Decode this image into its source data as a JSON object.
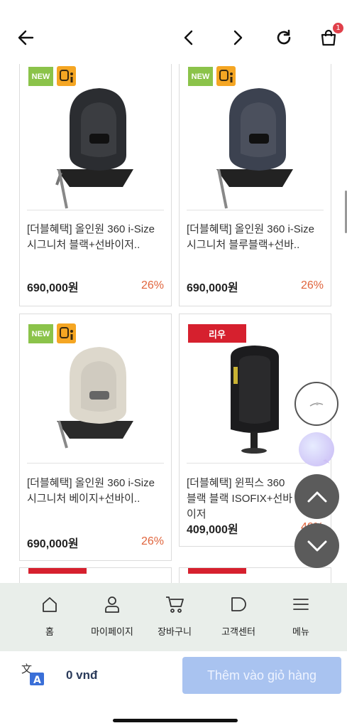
{
  "header": {
    "back_icon": "arrow-left-icon",
    "prev_icon": "chevron-left-icon",
    "next_icon": "chevron-right-icon",
    "reload_icon": "reload-icon",
    "cart_icon": "shopping-bag-icon",
    "cart_count": "1"
  },
  "products": [
    {
      "badges": [
        "NEW"
      ],
      "name": "[더블혜택] 올인원 360 i-Size 시그니처 블랙+선바이저..",
      "price": "690,000원",
      "discount": "26%",
      "seat_color": "#2b2d31"
    },
    {
      "badges": [
        "NEW"
      ],
      "name": "[더블혜택] 올인원 360 i-Size 시그니처 블루블랙+선바..",
      "price": "690,000원",
      "discount": "26%",
      "seat_color": "#3c4250"
    },
    {
      "badges": [
        "NEW"
      ],
      "name": "[더블혜택] 올인원 360 i-Size 시그니처 베이지+선바이..",
      "price": "690,000원",
      "discount": "26%",
      "seat_color": "#ddd8cc"
    },
    {
      "badges": [
        "리우"
      ],
      "name": "[더블혜택] 윈픽스 360 블랙 블랙 ISOFIX+선바이저",
      "price": "409,000원",
      "discount": "40%",
      "seat_color": "#1c1c1e"
    }
  ],
  "bottom_nav": [
    {
      "label": "홈",
      "icon": "home-icon"
    },
    {
      "label": "마이페이지",
      "icon": "user-icon"
    },
    {
      "label": "장바구니",
      "icon": "cart-icon"
    },
    {
      "label": "고객센터",
      "icon": "chat-bubble-icon"
    },
    {
      "label": "메뉴",
      "icon": "menu-icon"
    }
  ],
  "action_bar": {
    "translate_icon": "translate-icon",
    "amount": "0 vnđ",
    "add_to_cart_label": "Thêm vào giỏ hàng"
  },
  "colors": {
    "accent_discount": "#e0643c",
    "badge_new": "#8bc34a",
    "badge_red": "#d6202e",
    "add_button": "#a9c3f0",
    "nav_bg": "#e9eeea"
  }
}
